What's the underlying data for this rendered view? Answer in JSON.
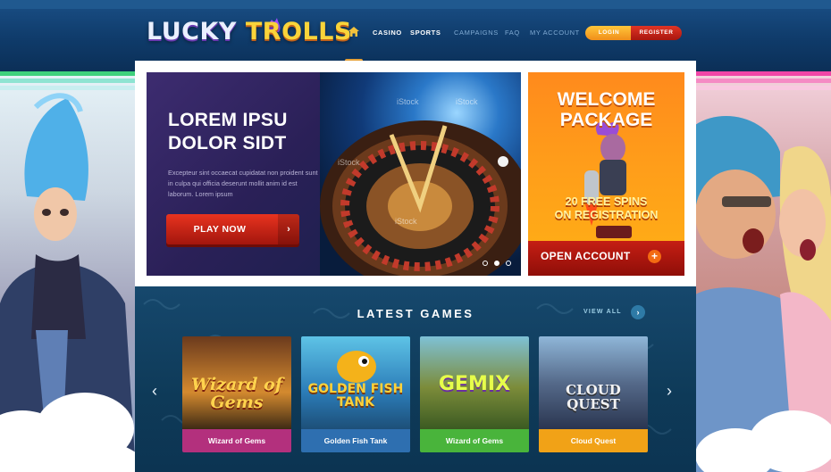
{
  "header": {
    "logo_part1": "LUCKY",
    "logo_part2": "TROLLS",
    "nav_primary": [
      "CASINO",
      "SPORTS"
    ],
    "nav_secondary": [
      "CAMPAIGNS",
      "FAQ",
      "MY ACCOUNT"
    ],
    "login_label": "LOGIN",
    "register_label": "REGISTER"
  },
  "hero": {
    "title": "LOREM IPSU DOLOR SIDT",
    "text": "Excepteur sint occaecat cupidatat non proident sunt in culpa qui officia deserunt mollit anim id est laborum. Lorem ipsum",
    "play_label": "PLAY NOW",
    "watermarks": [
      "iStock",
      "iStock",
      "iStock",
      "iStock"
    ]
  },
  "promo": {
    "title_line1": "WELCOME",
    "title_line2": "PACKAGE",
    "sub_line1": "20 FREE SPINS",
    "sub_line2": "ON REGISTRATION",
    "cta_label": "OPEN ACCOUNT"
  },
  "games": {
    "title": "LATEST GAMES",
    "view_all": "VIEW ALL",
    "items": [
      {
        "name": "Wizard of Gems",
        "art": "Wizard of Gems",
        "color": "#b3307d"
      },
      {
        "name": "Golden Fish Tank",
        "art": "GOLDEN FISH TANK",
        "color": "#2e6fb0"
      },
      {
        "name": "Wizard of Gems",
        "art": "GEMIX",
        "color": "#49b43b"
      },
      {
        "name": "Cloud Quest",
        "art": "CLOUD QUEST",
        "color": "#f1a217"
      }
    ]
  },
  "colors": {
    "accent_orange": "#f08e1a",
    "accent_red": "#c51e14",
    "header_blue": "#0f3b6a"
  },
  "icons": [
    "home-icon",
    "chevron-right-icon",
    "chevron-left-icon",
    "plus-icon"
  ]
}
